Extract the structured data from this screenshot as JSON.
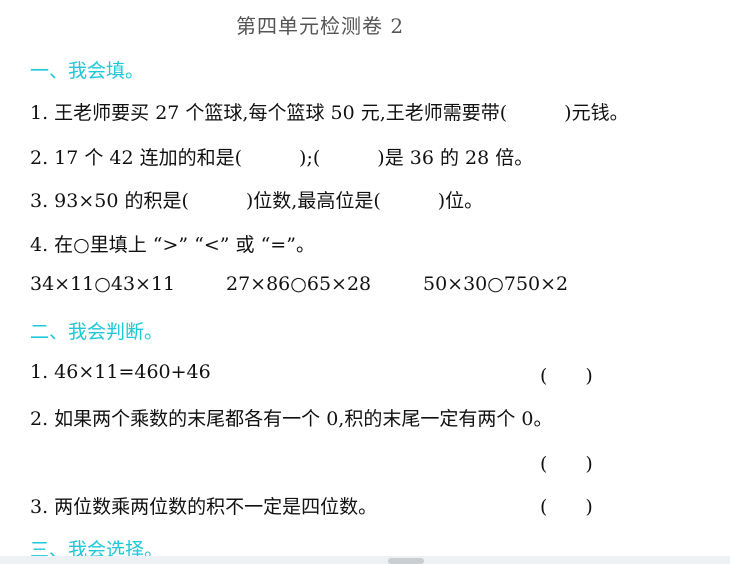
{
  "title": "第四单元检测卷 2",
  "sections": {
    "fill": "一、我会填。",
    "judge": "二、我会判断。",
    "choose": "三、我会选择。"
  },
  "fill_items": [
    "1. 王老师要买 27 个篮球,每个篮球 50 元,王老师需要带(　　　)元钱。",
    "2. 17 个 42 连加的和是(　　　);(　　　)是 36 的 28 倍。",
    "3. 93×50 的积是(　　　)位数,最高位是(　　　)位。",
    "4. 在○里填上 “>” “<” 或 “=”。"
  ],
  "compare_exprs": [
    "34×11○43×11",
    "27×86○65×28",
    "50×30○750×2"
  ],
  "judge_items": [
    "1. 46×11=460+46",
    "2. 如果两个乘数的末尾都各有一个 0,积的末尾一定有两个 0。",
    "3. 两位数乘两位数的积不一定是四位数。"
  ],
  "answer_paren": "(　　)",
  "colors": {
    "section": "#1ec8d8",
    "title": "#555555",
    "text": "#111111"
  }
}
